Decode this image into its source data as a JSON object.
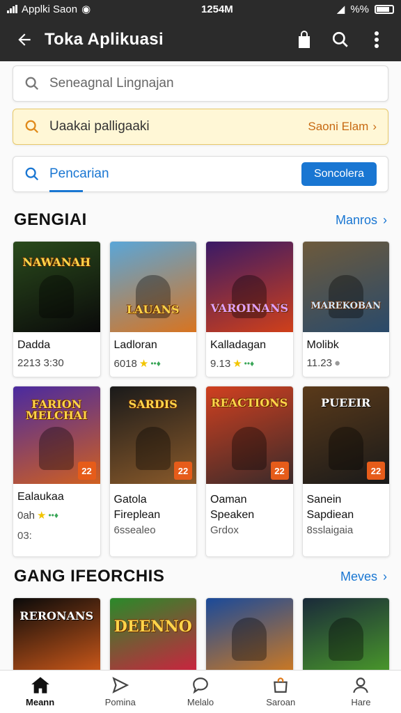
{
  "status_bar": {
    "carrier": "Applki Saon",
    "time": "1254M",
    "battery": "%%"
  },
  "app_bar": {
    "title": "Toka Aplikuasi"
  },
  "search": {
    "placeholder": "Seneagnal Lingnajan",
    "promo_text": "Uaakai palligaaki",
    "promo_action": "Saoni Elam",
    "tab_label": "Pencarian",
    "tab_button": "Soncolera"
  },
  "section1": {
    "title": "GENGIAI",
    "more": "Manros",
    "items": [
      {
        "art": "NAWANAH",
        "name": "Dadda",
        "meta": "2213 3:30",
        "colors": [
          "#2a4a1c",
          "#0a0a0a"
        ]
      },
      {
        "art": "LAUANS",
        "name": "Ladloran",
        "meta": "6018",
        "star": true,
        "colors": [
          "#5aa6d8",
          "#d87420"
        ]
      },
      {
        "art": "VAROINANS",
        "name": "Kalladagan",
        "meta": "9.13",
        "star": true,
        "colors": [
          "#3a1a66",
          "#d0401a"
        ]
      },
      {
        "art": "MAREKOBAN",
        "name": "Molibk",
        "meta": "11.23",
        "colors": [
          "#6d5a3c",
          "#2a4a6a"
        ]
      }
    ]
  },
  "section2": {
    "items": [
      {
        "art": "FARION MELCHAI",
        "name": "Ealaukaa",
        "meta": "0ah",
        "sub": "03:",
        "star": true,
        "badge": "22",
        "colors": [
          "#4a2aa0",
          "#d06020"
        ]
      },
      {
        "art": "SARDIS",
        "name": "Gatola",
        "line2": "Fireplean",
        "sub": "6ssealeo",
        "badge": "22",
        "colors": [
          "#1a1a1a",
          "#8a5a2a"
        ]
      },
      {
        "art": "REACTIONS",
        "name": "Oaman",
        "line2": "Speaken",
        "sub": "Grdox",
        "badge": "22",
        "colors": [
          "#d04020",
          "#3a2a2a"
        ]
      },
      {
        "art": "PUEEIR",
        "name": "Sanein",
        "line2": "Sapdiean",
        "sub": "8sslaigaia",
        "badge": "22",
        "colors": [
          "#5a3a1a",
          "#1a1a1a"
        ]
      }
    ]
  },
  "section3": {
    "title": "GANG IFEORCHIS",
    "more": "Meves",
    "items": [
      {
        "art": "RERONANS",
        "colors": [
          "#0a0a0a",
          "#d05a1a"
        ]
      },
      {
        "art": "DEENNO",
        "colors": [
          "#2a8a2a",
          "#d02040"
        ]
      },
      {
        "art": "",
        "colors": [
          "#1a4a9a",
          "#d07a20"
        ]
      },
      {
        "art": "",
        "colors": [
          "#1a2a3a",
          "#4a9a2a"
        ]
      }
    ]
  },
  "tabs": [
    {
      "label": "Meann",
      "icon": "home-icon"
    },
    {
      "label": "Pomina",
      "icon": "send-icon"
    },
    {
      "label": "Melalo",
      "icon": "chat-icon"
    },
    {
      "label": "Saroan",
      "icon": "shop-icon"
    },
    {
      "label": "Hare",
      "icon": "profile-icon"
    }
  ],
  "accent": "#1976d2"
}
